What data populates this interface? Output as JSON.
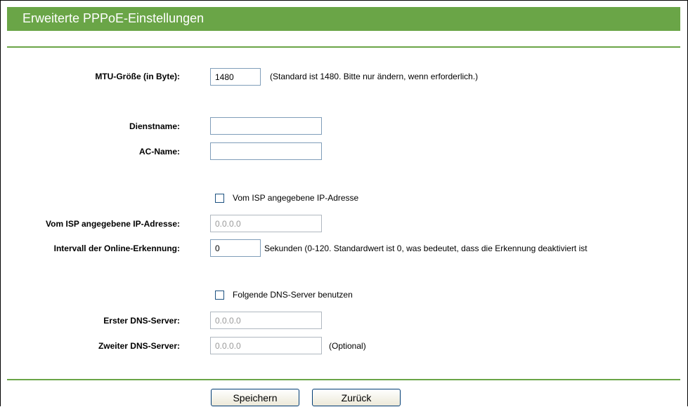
{
  "header": {
    "title": "Erweiterte PPPoE-Einstellungen"
  },
  "mtu": {
    "label": "MTU-Größe (in Byte):",
    "value": "1480",
    "hint": "(Standard ist 1480. Bitte nur ändern, wenn erforderlich.)"
  },
  "service_name": {
    "label": "Dienstname:",
    "value": ""
  },
  "ac_name": {
    "label": "AC-Name:",
    "value": ""
  },
  "isp_ip": {
    "checkbox_label": "Vom ISP angegebene IP-Adresse",
    "checked": false,
    "label": "Vom ISP angegebene IP-Adresse:",
    "value": "0.0.0.0"
  },
  "online_detection": {
    "label": "Intervall der Online-Erkennung:",
    "value": "0",
    "hint": "Sekunden (0-120. Standardwert ist 0, was bedeutet, dass die Erkennung deaktiviert ist"
  },
  "dns": {
    "checkbox_label": "Folgende DNS-Server benutzen",
    "checked": false,
    "primary_label": "Erster DNS-Server:",
    "primary_value": "0.0.0.0",
    "secondary_label": "Zweiter DNS-Server:",
    "secondary_value": "0.0.0.0",
    "secondary_hint": "(Optional)"
  },
  "buttons": {
    "save": "Speichern",
    "back": "Zurück"
  },
  "colors": {
    "accent": "#6aa547"
  }
}
